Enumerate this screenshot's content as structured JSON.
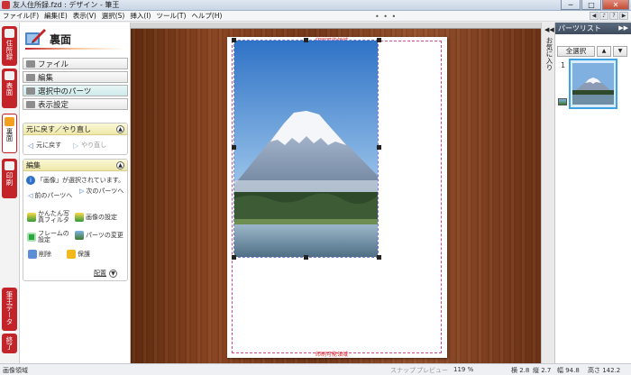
{
  "window": {
    "title": "友人住所録.fzd : デザイン - 筆王"
  },
  "menubar": {
    "items": [
      "ファイル(F)",
      "編集(E)",
      "表示(V)",
      "選択(S)",
      "挿入(I)",
      "ツール(T)",
      "ヘルプ(H)"
    ]
  },
  "left_tabs": [
    {
      "label": "住所録",
      "active": false
    },
    {
      "label": "表面",
      "active": false
    },
    {
      "label": "裏面",
      "active": true
    },
    {
      "label": "印刷",
      "active": false
    },
    {
      "label": "筆王データ",
      "active": false
    },
    {
      "label": "終了",
      "active": false
    }
  ],
  "left_panel": {
    "title": "裏面",
    "accordion": [
      {
        "label": "ファイル"
      },
      {
        "label": "編集"
      },
      {
        "label": "選択中のパーツ",
        "selected": true
      },
      {
        "label": "表示設定"
      }
    ],
    "undo_card": {
      "title": "元に戻す／やり直し",
      "undo_label": "元に戻す",
      "redo_label": "やり直し"
    },
    "edit_card": {
      "title": "編集",
      "info": "「画像」が選択されています。",
      "prev_part": "前のパーツへ",
      "next_part": "次のパーツへ",
      "quick_filter": "かんたん写真フィルタ",
      "image_settings": "画像の設定",
      "frame_settings": "フレームの設定",
      "change_part": "パーツの変更",
      "delete": "削除",
      "protect": "保護",
      "arrange": "配置"
    }
  },
  "canvas": {
    "print_label_top": "印刷可能領域",
    "print_label_bottom": "印刷可能領域"
  },
  "right_panel": {
    "title": "パーツリスト",
    "favorites": "お気に入り",
    "select_all": "全選択",
    "item_number": "1"
  },
  "statusbar": {
    "left": "画像領域",
    "snap": "スナップ",
    "preview": "プレビュー",
    "zoom": "119 %",
    "pos_x": "横 2.8",
    "pos_y": "縦 2.7",
    "width": "幅 94.8",
    "height": "高さ 142.2"
  },
  "colors": {
    "accent": "#c2242a",
    "panel_header": "#efe8a8",
    "selection": "#3fa3e2"
  }
}
